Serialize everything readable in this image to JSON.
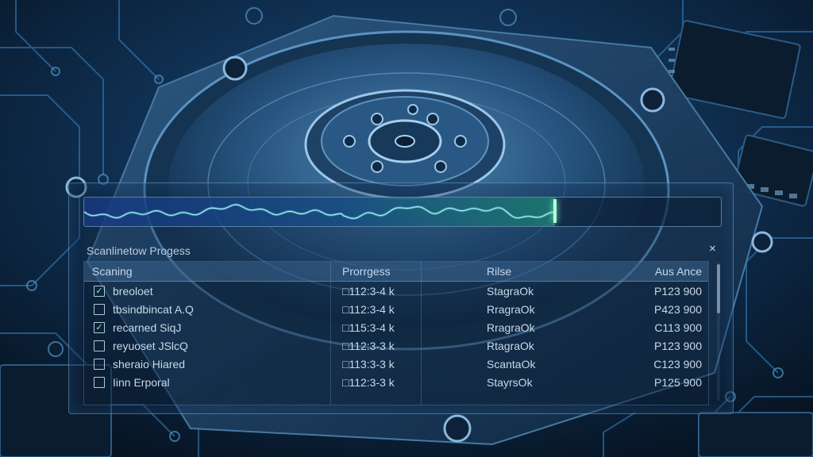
{
  "window": {
    "title": "Scanlinetow Progess",
    "close_glyph": "×"
  },
  "scan_wave": {
    "progress": 0.74
  },
  "table": {
    "columns": [
      "Scaning",
      "Prorrgess",
      "Rilse",
      "Aus Ance"
    ],
    "rows": [
      {
        "checked": true,
        "name": "breoloet",
        "progress": "□112:3-4 k",
        "status": "StagraOk",
        "value": "P123 900"
      },
      {
        "checked": false,
        "name": "tbsindbincat A.Q",
        "progress": "□112:3-4 k",
        "status": "RragraOk",
        "value": "P423 900"
      },
      {
        "checked": true,
        "name": "recarned SiqJ",
        "progress": "□115:3-4 k",
        "status": "RragraOk",
        "value": "C113 900"
      },
      {
        "checked": false,
        "name": "reyuoset JSlcQ",
        "progress": "□112:3-3 k",
        "status": "RtagraOk",
        "value": "P123 900"
      },
      {
        "checked": false,
        "name": "sheraio Hiared",
        "progress": "□113:3-3 k",
        "status": "ScantaOk",
        "value": "C123 900"
      },
      {
        "checked": false,
        "name": "Iinn Erporal",
        "progress": "□112:3-3 k",
        "status": "StayrsOk",
        "value": "P125 900"
      }
    ]
  },
  "colors": {
    "accent_green": "#7dffc8",
    "accent_blue": "#3a8de0",
    "panel_border": "#8cbee6"
  },
  "icons": [
    "check-icon",
    "close-icon",
    "hard-drive-platter",
    "circuit-trace"
  ]
}
